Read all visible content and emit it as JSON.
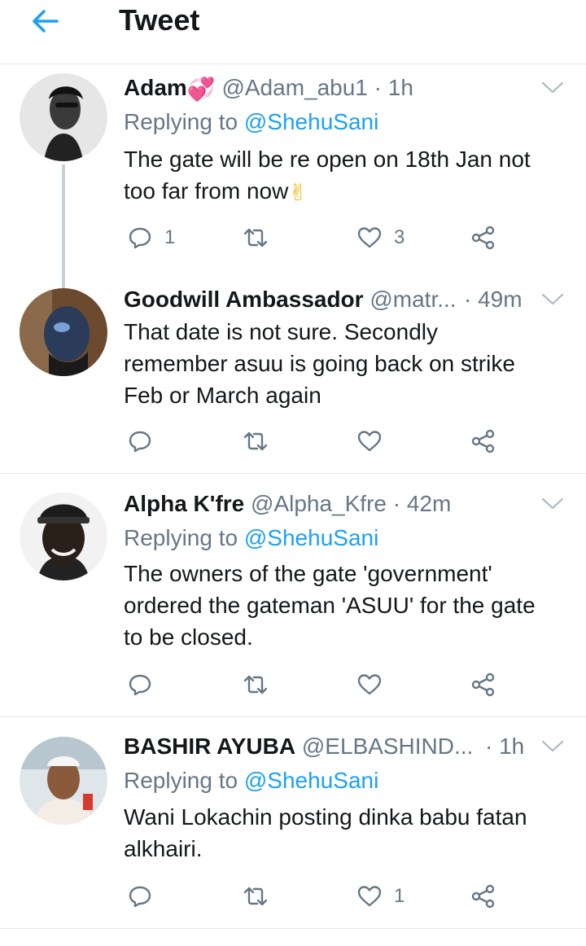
{
  "header": {
    "title": "Tweet"
  },
  "colors": {
    "accent": "#1da1f2",
    "secondary_text": "#657786",
    "divider": "#e1e8ed"
  },
  "tweets": [
    {
      "name": "Adam",
      "name_emoji": "💞",
      "handle": "@Adam_abu1",
      "time": "· 1h",
      "replying_prefix": "Replying to",
      "replying_to": "@ShehuSani",
      "text_line1": "The gate will be re open on 18th Jan not",
      "text_line2": "too far from now",
      "text_emoji": "✌",
      "reply_count": "1",
      "retweet_count": "",
      "like_count": "3"
    },
    {
      "name": "Goodwill Ambassador",
      "handle": "@matr...",
      "time": "· 49m",
      "text_line1": "That date is not sure. Secondly",
      "text_line2": "remember asuu is going back on strike",
      "text_line3": "Feb or March again",
      "reply_count": "",
      "retweet_count": "",
      "like_count": ""
    },
    {
      "name": "Alpha K'fre",
      "handle": "@Alpha_Kfre",
      "time": "· 42m",
      "replying_prefix": "Replying to",
      "replying_to": "@ShehuSani",
      "text_line1": "The owners of the gate 'government'",
      "text_line2": "ordered the gateman 'ASUU' for the gate",
      "text_line3": "to be closed.",
      "reply_count": "",
      "retweet_count": "",
      "like_count": ""
    },
    {
      "name": "BASHIR AYUBA",
      "handle": "@ELBASHIND...",
      "time": "· 1h",
      "replying_prefix": "Replying to",
      "replying_to": "@ShehuSani",
      "text_line1": "Wani Lokachin posting dinka babu fatan",
      "text_line2": "alkhairi.",
      "reply_count": "",
      "retweet_count": "",
      "like_count": "1"
    }
  ]
}
